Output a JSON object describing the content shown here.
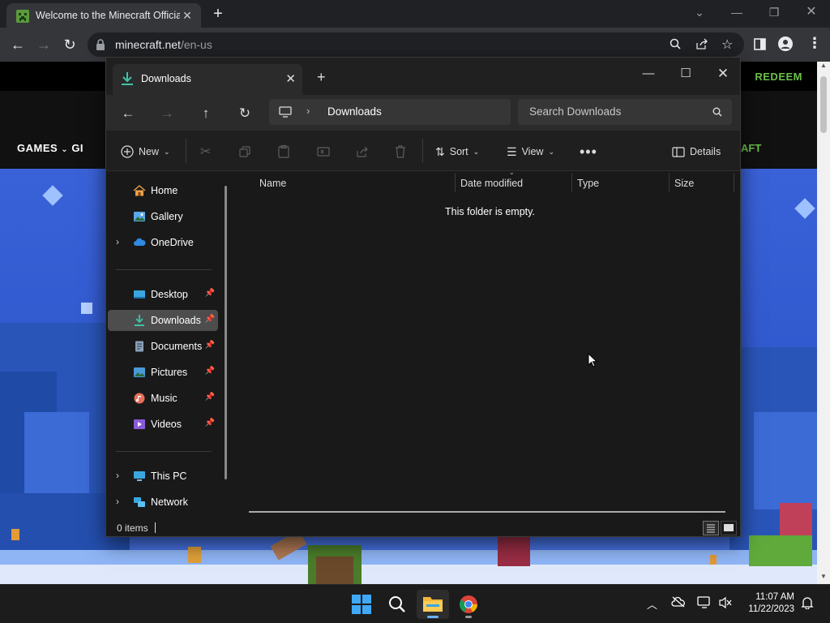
{
  "chrome": {
    "tab_title": "Welcome to the Minecraft Official Site | Minecraft",
    "url_domain": "minecraft.net",
    "url_path": "/en-us"
  },
  "site": {
    "redeem": "REDEEM",
    "games": "GAMES",
    "gift_partial": "GI",
    "craft_partial": "AFT"
  },
  "explorer": {
    "tab_title": "Downloads",
    "breadcrumb": "Downloads",
    "search_placeholder": "Search Downloads",
    "cmd": {
      "new": "New",
      "sort": "Sort",
      "view": "View",
      "details": "Details"
    },
    "nav": {
      "home": "Home",
      "gallery": "Gallery",
      "onedrive": "OneDrive",
      "desktop": "Desktop",
      "downloads": "Downloads",
      "documents": "Documents",
      "pictures": "Pictures",
      "music": "Music",
      "videos": "Videos",
      "thispc": "This PC",
      "network": "Network"
    },
    "columns": {
      "name": "Name",
      "date": "Date modified",
      "type": "Type",
      "size": "Size"
    },
    "empty_message": "This folder is empty.",
    "status_count": "0 items"
  },
  "taskbar": {
    "time": "11:07 AM",
    "date": "11/22/2023"
  },
  "colors": {
    "accent": "#6bb0ff",
    "hero_blue": "#3a62d8",
    "minecraft_green": "#6cc04a"
  }
}
